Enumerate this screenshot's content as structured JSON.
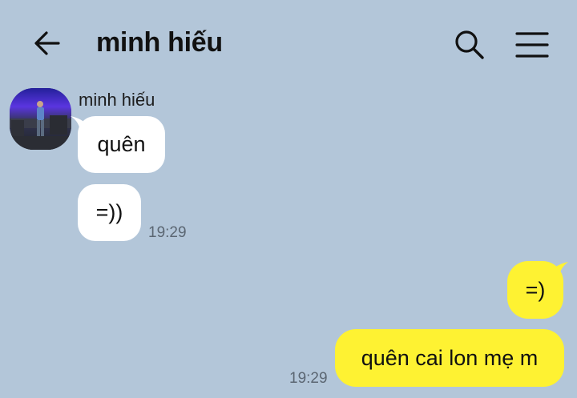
{
  "header": {
    "title": "minh hiếu",
    "back_icon": "arrow-left-icon",
    "search_icon": "search-icon",
    "menu_icon": "hamburger-menu-icon"
  },
  "colors": {
    "background": "#b3c6d9",
    "incoming_bubble": "#ffffff",
    "outgoing_bubble": "#fef232",
    "timestamp": "#5b6672"
  },
  "messages": [
    {
      "sender": "minh hiếu",
      "direction": "incoming",
      "text": "quên"
    },
    {
      "direction": "incoming",
      "text": "=))",
      "time": "19:29"
    },
    {
      "direction": "outgoing",
      "text": "=)"
    },
    {
      "direction": "outgoing",
      "text": "quên cai lon mẹ m",
      "time": "19:29"
    }
  ]
}
